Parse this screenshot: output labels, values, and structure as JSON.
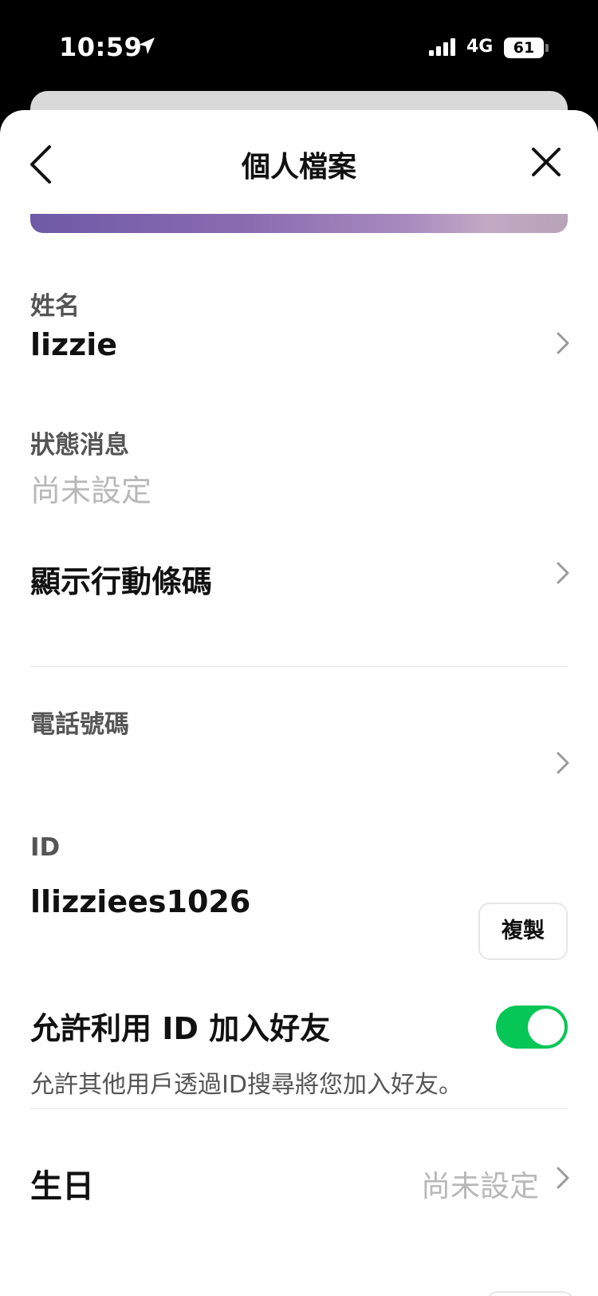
{
  "status_bar": {
    "time": "10:59",
    "network": "4G",
    "battery": "61"
  },
  "header": {
    "title": "個人檔案"
  },
  "profile": {
    "name_label": "姓名",
    "name_value": "lizzie",
    "status_label": "狀態消息",
    "status_value": "尚未設定",
    "barcode_label": "顯示行動條碼",
    "phone_label": "電話號碼",
    "phone_value": "",
    "id_label": "ID",
    "id_value": "llizziees1026",
    "copy_label": "複製",
    "allow_id_label": "允許利用 ID 加入好友",
    "allow_id_desc": "允許其他用戶透過ID搜尋將您加入好友。",
    "allow_id_enabled": true,
    "birthday_label": "生日",
    "birthday_value": "尚未設定"
  },
  "colors": {
    "toggle_on": "#06c755",
    "muted_text": "#b8b8b8",
    "label_text": "#555555"
  }
}
